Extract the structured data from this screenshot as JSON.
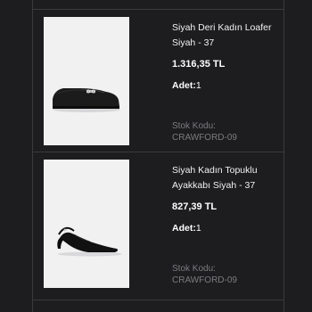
{
  "cart": {
    "items": [
      {
        "name": "Siyah Deri Kadın Loafer Siyah - 37",
        "price": "1.316,35 TL",
        "quantity_label": "Adet:",
        "quantity": "1",
        "sku_label": "Stok Kodu:",
        "sku": "CRAWFORD-09",
        "image_icon": "black-leather-loafer-image"
      },
      {
        "name": "Siyah Kadın Topuklu Ayakkabı Siyah - 37",
        "price": "827,39 TL",
        "quantity_label": "Adet:",
        "quantity": "1",
        "sku_label": "Stok Kodu:",
        "sku": "CRAWFORD-09",
        "image_icon": "black-slingback-heel-image"
      }
    ]
  },
  "colors": {
    "background": "#1d1d1f",
    "divider": "#3a3a3c",
    "text": "#ffffff",
    "muted_text": "#7c7c80",
    "thumbnail_bg": "#f1f1f2"
  }
}
